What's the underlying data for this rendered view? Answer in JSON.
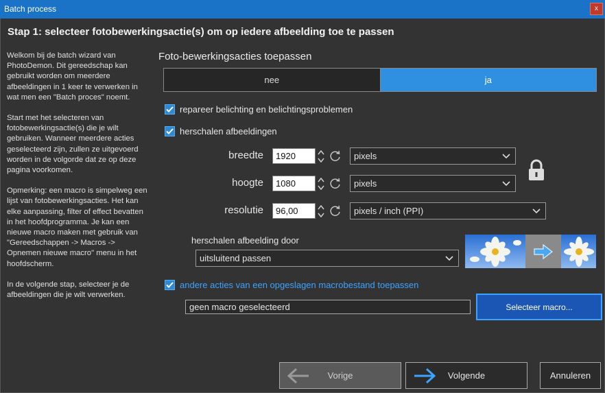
{
  "window": {
    "title": "Batch process",
    "close_glyph": "x"
  },
  "heading": "Stap 1: selecteer fotobewerkingsactie(s) om op iedere afbeelding toe te passen",
  "help": {
    "p1": "Welkom bij de batch wizard van PhotoDemon. Dit gereedschap kan gebruikt worden om meerdere afbeeldingen in 1 keer te verwerken in wat men een \"Batch proces\" noemt.",
    "p2": "Start met het selecteren van fotobewerkingsactie(s) die je wilt gebruiken. Wanneer meerdere acties geselecteerd zijn, zullen ze uitgevoerd worden in de volgorde dat ze op deze pagina voorkomen.",
    "p3": "Opmerking: een macro is simpelweg een lijst van fotobewerkingsacties. Het kan elke aanpassing, filter of effect bevatten in het hoofdprogramma. Je kan een nieuwe macro maken met gebruik van \"Gereedschappen -> Macros -> Opnemen nieuwe macro\" menu in het hoofdscherm.",
    "p4": "In de volgende stap, selecteer je de afbeeldingen die je wilt verwerken."
  },
  "actions": {
    "title": "Foto-bewerkingsacties toepassen",
    "toggle": {
      "off_label": "nee",
      "on_label": "ja",
      "selected": "ja"
    },
    "repair_exposure": {
      "label": "repareer belichting en belichtingsproblemen",
      "checked": true
    },
    "resize": {
      "label": "herschalen afbeeldingen",
      "checked": true,
      "width": {
        "label": "breedte",
        "value": "1920",
        "unit": "pixels"
      },
      "height": {
        "label": "hoogte",
        "value": "1080",
        "unit": "pixels"
      },
      "resolution": {
        "label": "resolutie",
        "value": "96,00",
        "unit": "pixels / inch (PPI)"
      },
      "lock_icon": "lock-icon",
      "fit_label": "herschalen afbeelding door",
      "fit_mode": "uitsluitend passen"
    },
    "macro": {
      "label": "andere acties van een opgeslagen macrobestand toepassen",
      "checked": true,
      "file_value": "geen macro geselecteerd",
      "select_button": "Selecteer macro..."
    }
  },
  "footer": {
    "prev_label": "Vorige",
    "next_label": "Volgende",
    "cancel_label": "Annuleren"
  },
  "colors": {
    "titlebar": "#1a73c7",
    "accent": "#2f8fe0",
    "accent_text": "#3ea3ff",
    "background": "#333333",
    "macro_button": "#1b56b5"
  }
}
